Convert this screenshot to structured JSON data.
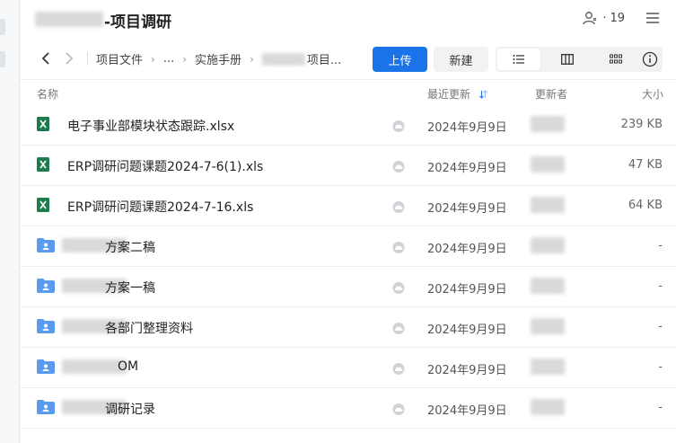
{
  "header": {
    "title": "-项目调研",
    "member_count": "19"
  },
  "toolbar": {
    "breadcrumb": [
      "项目文件",
      "...",
      "实施手册",
      "项目..."
    ],
    "upload_label": "上传",
    "new_label": "新建"
  },
  "columns": {
    "name": "名称",
    "modified": "最近更新",
    "updater": "更新者",
    "size": "大小"
  },
  "colors": {
    "primary": "#1a73e8",
    "excel": "#1d7c4d",
    "folder": "#5b9bef"
  },
  "files": [
    {
      "type": "excel",
      "name": "电子事业部模块状态跟踪.xlsx",
      "date": "2024年9月9日",
      "size": "239 KB"
    },
    {
      "type": "excel",
      "name": "ERP调研问题课题2024-7-6(1).xls",
      "date": "2024年9月9日",
      "size": "47 KB"
    },
    {
      "type": "excel",
      "name": "ERP调研问题课题2024-7-16.xls",
      "date": "2024年9月9日",
      "size": "64 KB"
    },
    {
      "type": "folder",
      "name": "方案二稿",
      "date": "2024年9月9日",
      "size": "-"
    },
    {
      "type": "folder",
      "name": "方案一稿",
      "date": "2024年9月9日",
      "size": "-"
    },
    {
      "type": "folder",
      "name": "各部门整理资料",
      "date": "2024年9月9日",
      "size": "-"
    },
    {
      "type": "folder",
      "name": "OM",
      "date": "2024年9月9日",
      "size": "-"
    },
    {
      "type": "folder",
      "name": "调研记录",
      "date": "2024年9月9日",
      "size": "-"
    }
  ]
}
